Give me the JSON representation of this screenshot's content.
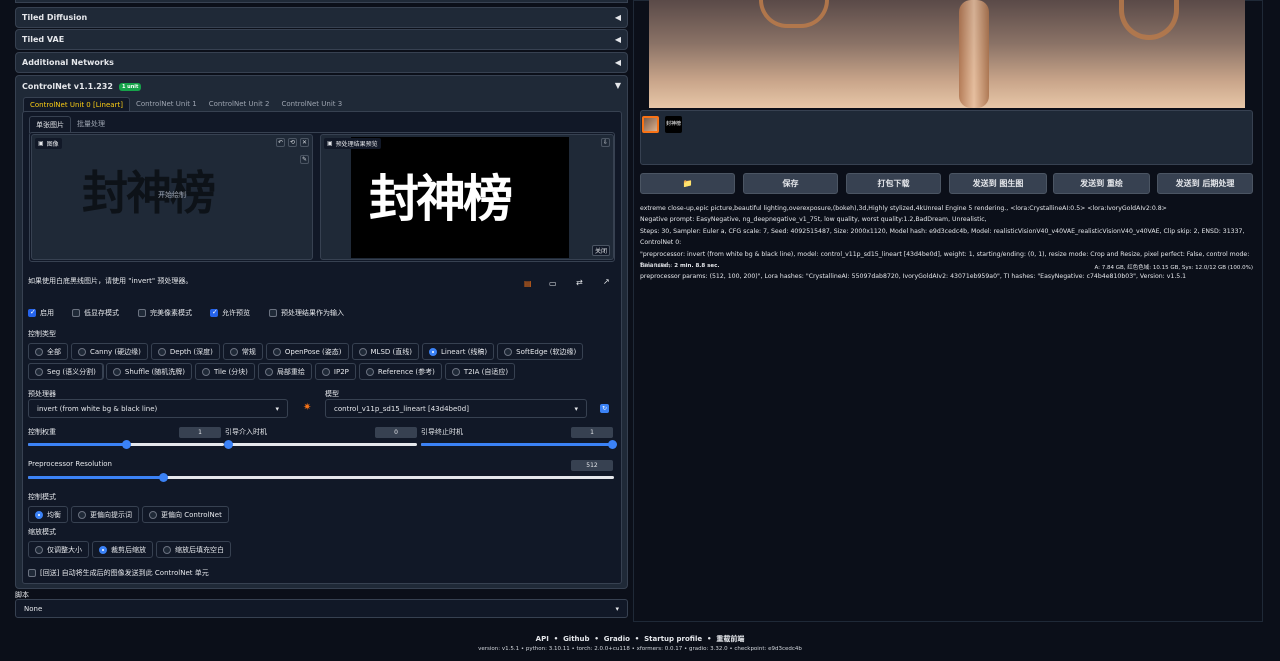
{
  "accordions": {
    "tiled_diffusion": "Tiled Diffusion",
    "tiled_vae": "Tiled VAE",
    "additional_networks": "Additional Networks"
  },
  "controlnet": {
    "title": "ControlNet v1.1.232",
    "badge": "1 unit",
    "unit_tabs": [
      "ControlNet Unit 0 [Lineart]",
      "ControlNet Unit 1",
      "ControlNet Unit 2",
      "ControlNet Unit 3"
    ],
    "image_tabs": [
      "单张图片",
      "批量处理"
    ],
    "image_label": "图像",
    "image_hint": "开始绘制",
    "preview_label": "预处理结果预览",
    "close_btn": "关闭",
    "calligraphy": "封神榜",
    "hint": "如果使用白底黑线图片，请使用 \"invert\" 预处理器。",
    "checks": [
      {
        "label": "启用",
        "on": true
      },
      {
        "label": "低显存模式",
        "on": false
      },
      {
        "label": "完美像素模式",
        "on": false
      },
      {
        "label": "允许预览",
        "on": true
      },
      {
        "label": "预处理结果作为输入",
        "on": false
      }
    ],
    "control_type_label": "控制类型",
    "control_types_row1": [
      "全部",
      "Canny (硬边缘)",
      "Depth (深度)",
      "常规",
      "OpenPose (姿态)",
      "MLSD (直线)",
      "Lineart (线稿)",
      "SoftEdge (软边缘)",
      "Scribble (涂鸦)"
    ],
    "control_types_row2": [
      "Seg (语义分割)",
      "Shuffle (随机洗牌)",
      "Tile (分块)",
      "局部重绘",
      "IP2P",
      "Reference (参考)",
      "T2IA (自适应)"
    ],
    "control_type_selected": "Lineart (线稿)",
    "preprocessor_label": "预处理器",
    "preprocessor_value": "invert (from white bg & black line)",
    "model_label": "模型",
    "model_value": "control_v11p_sd15_lineart [43d4be0d]",
    "weight_label": "控制权重",
    "weight_value": "1",
    "weight_frac": 0.5,
    "start_label": "引导介入时机",
    "start_value": "0",
    "start_frac": 0,
    "end_label": "引导终止时机",
    "end_value": "1",
    "end_frac": 1,
    "resolution_label": "Preprocessor Resolution",
    "resolution_value": "512",
    "resolution_frac": 0.23,
    "control_mode_label": "控制模式",
    "control_modes": [
      "均衡",
      "更偏向提示词",
      "更偏向 ControlNet"
    ],
    "control_mode_selected": "均衡",
    "resize_mode_label": "缩放模式",
    "resize_modes": [
      "仅调整大小",
      "裁剪后缩放",
      "缩放后填充空白"
    ],
    "resize_mode_selected": "裁剪后缩放",
    "loopback": "[回送] 自动将生成后的图像发送到此 ControlNet 单元"
  },
  "script": {
    "label": "脚本",
    "value": "None"
  },
  "output": {
    "buttons": [
      "📁",
      "保存",
      "打包下载",
      "发送到 图生图",
      "发送到 重绘",
      "发送到 后期处理"
    ],
    "info_lines": [
      "extreme close-up,epic picture,beautiful lighting,overexposure,(bokeh),3d,Highly stylized,4kUnreal Engine 5 rendering., <lora:CrystallineAI:0.5> <lora:IvoryGoldAIv2:0.8>",
      "Negative prompt: EasyNegative, ng_deepnegative_v1_75t, low quality, worst quality:1.2,BadDream, Unrealistic,",
      "Steps: 30, Sampler: Euler a, CFG scale: 7, Seed: 4092515487, Size: 2000x1120, Model hash: e9d3cedc4b, Model: realisticVisionV40_v40VAE_realisticVisionV40_v40VAE, Clip skip: 2, ENSD: 31337, ControlNet 0:",
      "\"preprocessor: invert (from white bg & black line), model: control_v11p_sd15_lineart [43d4be0d], weight: 1, starting/ending: (0, 1), resize mode: Crop and Resize, pixel perfect: False, control mode: Balanced,",
      "preprocessor params: (512, 100, 200)\", Lora hashes: \"CrystallineAI: 55097dab8720, IvoryGoldAIv2: 43071eb959a0\", TI hashes: \"EasyNegative: c74b4e810b03\", Version: v1.5.1"
    ],
    "time_taken_label": "Time taken:",
    "time_taken": "2 min. 8.8 sec.",
    "vram": "A: 7.84 GB, 红色色域: 10.15 GB, Sys: 12.0/12 GB (100.0%)"
  },
  "footer": {
    "links": [
      "API",
      "Github",
      "Gradio",
      "Startup profile",
      "重载前端"
    ],
    "version": "version: v1.5.1  •  python: 3.10.11  •  torch: 2.0.0+cu118  •  xformers: 0.0.17  •  gradio: 3.32.0  •  checkpoint: e9d3cedc4b"
  },
  "colors": {
    "bg": "#0b0f19",
    "panel": "#1f2937",
    "accent": "#3b82f6",
    "active_tab": "#facc15",
    "badge": "#16a34a"
  }
}
